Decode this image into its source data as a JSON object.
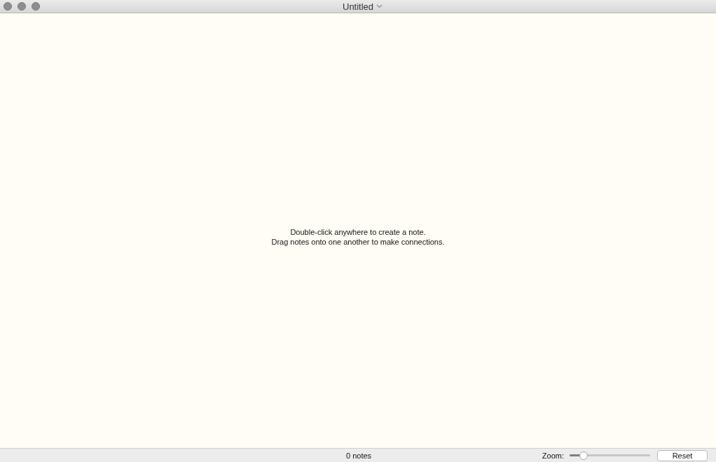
{
  "window": {
    "title": "Untitled"
  },
  "canvas": {
    "hint_lines": [
      "Double-click anywhere to create a note.",
      "Drag notes onto one another to make connections."
    ]
  },
  "status_bar": {
    "count": "0 notes",
    "zoom_label": "Zoom:",
    "zoom": {
      "level": 0.17
    },
    "reset_button": "Reset"
  }
}
